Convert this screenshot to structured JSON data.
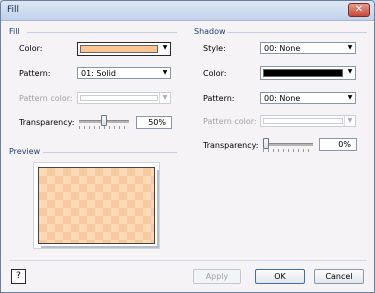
{
  "window": {
    "title": "Fill",
    "close_glyph": "✕"
  },
  "fill": {
    "section_title": "Fill",
    "color": {
      "label": "Color:",
      "swatch_color": "#fcc594"
    },
    "pattern": {
      "label": "Pattern:",
      "value": "01: Solid"
    },
    "pattern_color": {
      "label": "Pattern color:",
      "swatch_color": "#ffffff"
    },
    "transparency": {
      "label": "Transparency:",
      "value": "50%",
      "level": 0.5
    }
  },
  "shadow": {
    "section_title": "Shadow",
    "style": {
      "label": "Style:",
      "value": "00: None"
    },
    "color": {
      "label": "Color:",
      "swatch_color": "#000000"
    },
    "pattern": {
      "label": "Pattern:",
      "value": "00: None"
    },
    "pattern_color": {
      "label": "Pattern color:",
      "swatch_color": "#ffffff"
    },
    "transparency": {
      "label": "Transparency:",
      "value": "0%",
      "level": 0
    }
  },
  "preview": {
    "section_title": "Preview",
    "fill_color": "#fcd8b4",
    "pattern_color": "#f6c9a0"
  },
  "buttons": {
    "help": "?",
    "apply": "Apply",
    "ok": "OK",
    "cancel": "Cancel"
  },
  "icons": {
    "dropdown": "chevron-down-icon",
    "help": "help-icon",
    "close": "close-icon"
  }
}
